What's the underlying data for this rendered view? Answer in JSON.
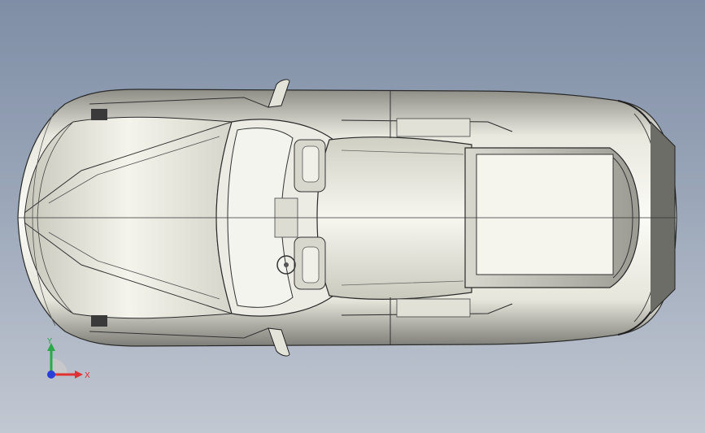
{
  "viewport": {
    "view": "top",
    "background_colors": [
      "#7f8ea6",
      "#c2c8d2"
    ],
    "model_color": "#e9e9e0",
    "edge_color": "#222222"
  },
  "triad": {
    "x_label": "X",
    "y_label": "Y",
    "x_color": "#e03030",
    "y_color": "#2aa84a",
    "z_color": "#2a3fd6"
  }
}
